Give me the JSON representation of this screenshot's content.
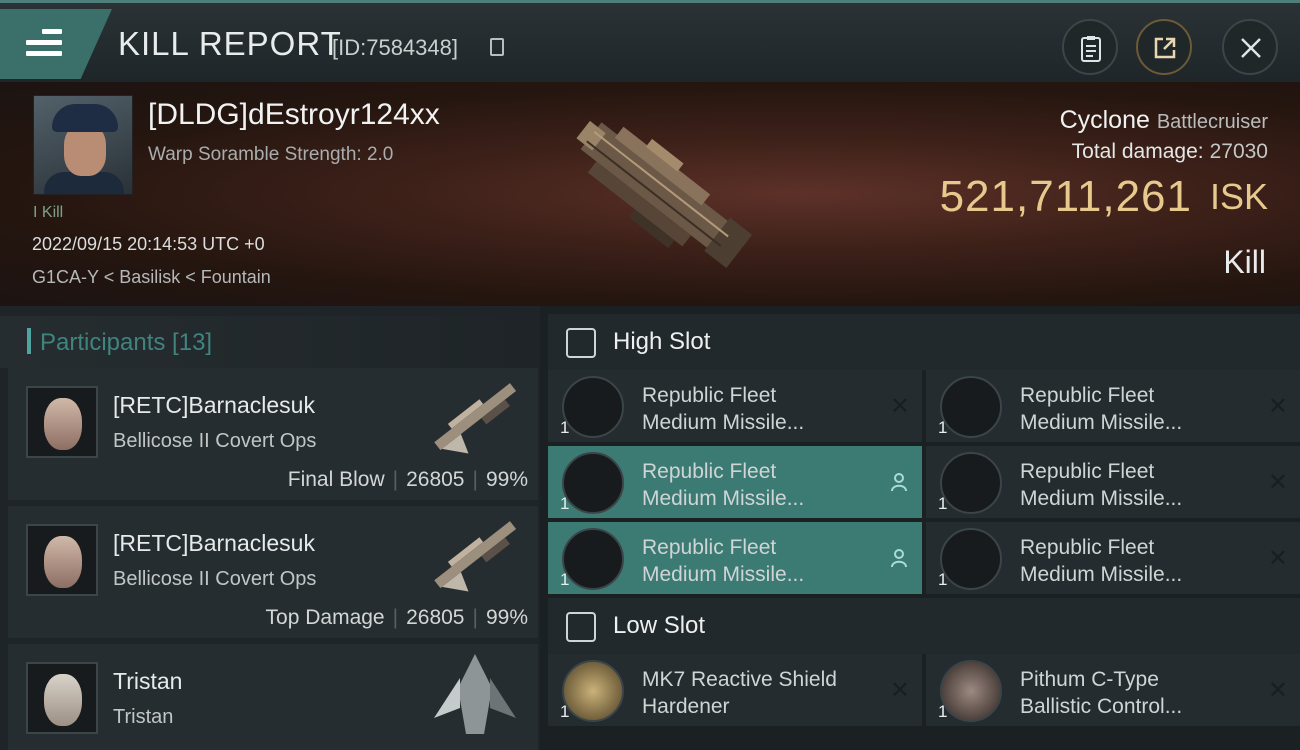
{
  "header": {
    "title": "KILL REPORT",
    "id_label": "[ID:7584348]"
  },
  "victim": {
    "name": "[DLDG]dEstroyr124xx",
    "warp_scramble": "Warp Soramble Strength: 2.0",
    "kill_tag": "I Kill",
    "datetime": "2022/09/15 20:14:53 UTC +0",
    "location": "G1CA-Y < Basilisk < Fountain",
    "ship": "Cyclone",
    "ship_class": "Battlecruiser",
    "total_damage_label": "Total damage:",
    "total_damage": "27030",
    "isk_value": "521,711,261",
    "isk_unit": "ISK",
    "result": "Kill"
  },
  "participants": {
    "header": "Participants [13]",
    "rows": [
      {
        "name": "[RETC]Barnaclesuk",
        "ship": "Bellicose II Covert Ops",
        "role": "Final Blow",
        "damage": "26805",
        "percent": "99%"
      },
      {
        "name": "[RETC]Barnaclesuk",
        "ship": "Bellicose II Covert Ops",
        "role": "Top Damage",
        "damage": "26805",
        "percent": "99%"
      },
      {
        "name": "Tristan",
        "ship": "Tristan"
      }
    ]
  },
  "slots": {
    "high_label": "High Slot",
    "low_label": "Low Slot",
    "high": [
      {
        "line1": "Republic Fleet",
        "line2": "Medium Missile...",
        "qty": "1"
      },
      {
        "line1": "Republic Fleet",
        "line2": "Medium Missile...",
        "qty": "1"
      },
      {
        "line1": "Republic Fleet",
        "line2": "Medium Missile...",
        "qty": "1"
      },
      {
        "line1": "Republic Fleet",
        "line2": "Medium Missile...",
        "qty": "1"
      },
      {
        "line1": "Republic Fleet",
        "line2": "Medium Missile...",
        "qty": "1"
      },
      {
        "line1": "Republic Fleet",
        "line2": "Medium Missile...",
        "qty": "1"
      }
    ],
    "low": [
      {
        "line1": "MK7 Reactive Shield",
        "line2": "Hardener",
        "qty": "1"
      },
      {
        "line1": "Pithum C-Type",
        "line2": "Ballistic Control...",
        "qty": "1"
      }
    ]
  },
  "colors": {
    "accent": "#3c7a74",
    "isk": "#e7c98e"
  }
}
